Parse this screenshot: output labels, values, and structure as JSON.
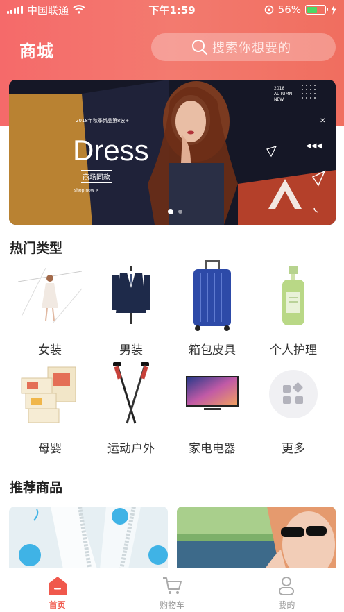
{
  "status_bar": {
    "carrier": "中国联通",
    "time": "下午1:59",
    "battery_percent": "56%",
    "battery_level": 0.56,
    "battery_color": "#4cd964"
  },
  "header": {
    "title": "商城",
    "search_placeholder": "搜索你想要的"
  },
  "banner": {
    "headline": "Dress",
    "caption": "商场同款",
    "small_top": "2018年秋季新品第8波+",
    "shop_now": "shop now >",
    "corner_lines": [
      "2018",
      "AUTUMN",
      "NEW"
    ],
    "active_page": 1,
    "page_count": 2
  },
  "hot_section": {
    "title": "热门类型",
    "items": [
      {
        "label": "女装",
        "icon": "womens-clothing-icon"
      },
      {
        "label": "男装",
        "icon": "mens-clothing-icon"
      },
      {
        "label": "箱包皮具",
        "icon": "luggage-icon"
      },
      {
        "label": "个人护理",
        "icon": "personal-care-icon"
      },
      {
        "label": "母婴",
        "icon": "mother-baby-icon"
      },
      {
        "label": "运动户外",
        "icon": "trekking-poles-icon"
      },
      {
        "label": "家电电器",
        "icon": "television-icon"
      },
      {
        "label": "更多",
        "icon": "more-grid-icon"
      }
    ]
  },
  "recommend_section": {
    "title": "推荐商品"
  },
  "tab_bar": {
    "items": [
      {
        "label": "首页",
        "icon": "home-icon",
        "active": true
      },
      {
        "label": "购物车",
        "icon": "cart-icon",
        "active": false
      },
      {
        "label": "我的",
        "icon": "profile-icon",
        "active": false
      }
    ],
    "accent": "#f0584c"
  }
}
